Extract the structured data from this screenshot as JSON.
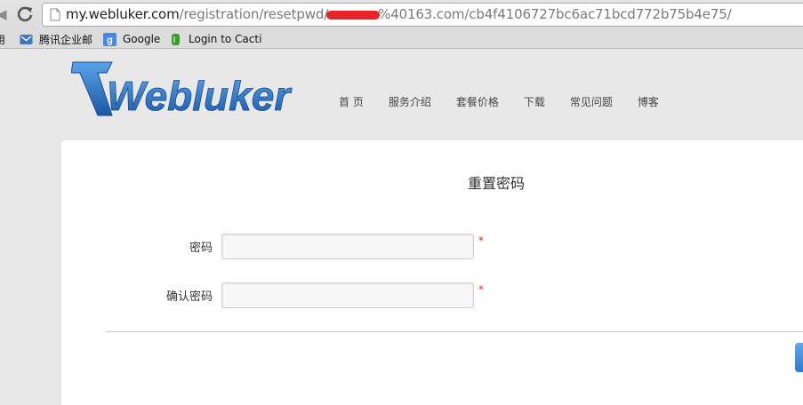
{
  "browser": {
    "url_host": "my.webluker.com",
    "url_path_start": "/registration/resetpwd/",
    "url_path_end": "%40163.com/cb4f4106727bc6ac71bcd772b75b4e75/"
  },
  "bookmarks": [
    {
      "label": "用",
      "icon": "bookmark-icon"
    },
    {
      "label": "腾讯企业邮",
      "icon": "tencent-mail-icon"
    },
    {
      "label": "Google",
      "icon": "google-icon"
    },
    {
      "label": "Login to Cacti",
      "icon": "cacti-icon"
    }
  ],
  "site": {
    "logo_text": "Webluker",
    "nav": [
      "首 页",
      "服务介绍",
      "套餐价格",
      "下载",
      "常见问题",
      "博客"
    ]
  },
  "form": {
    "title": "重置密码",
    "password_label": "密码",
    "confirm_label": "确认密码",
    "required_mark": "*"
  },
  "colors": {
    "accent": "#2f7bd0",
    "logo_blue": "#1f5fae",
    "required": "#dd3333"
  }
}
